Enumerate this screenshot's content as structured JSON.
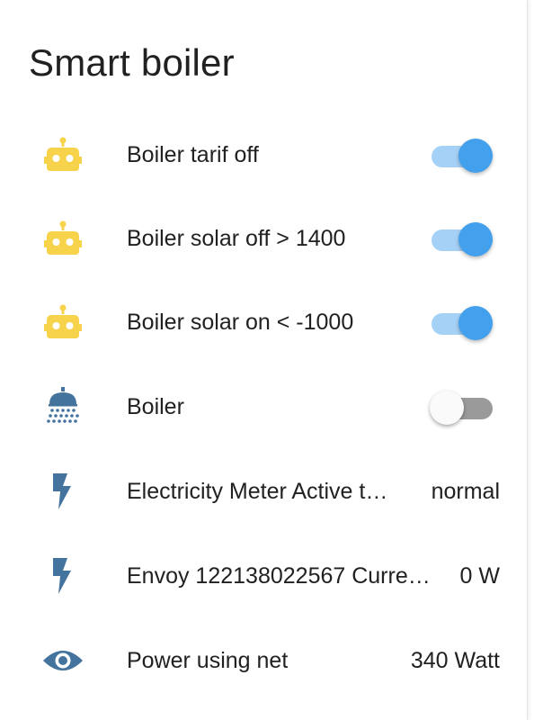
{
  "card": {
    "title": "Smart boiler"
  },
  "colors": {
    "robot_icon": "#f7d34c",
    "entity_icon": "#44739e",
    "toggle_on_knob": "#42a0ec",
    "toggle_on_track": "#a6d1f7",
    "toggle_off_track": "#9a9a9a"
  },
  "rows": [
    {
      "icon": "robot-icon",
      "name": "Boiler tarif off",
      "toggle": "on"
    },
    {
      "icon": "robot-icon",
      "name": "Boiler solar off > 1400",
      "toggle": "on"
    },
    {
      "icon": "robot-icon",
      "name": "Boiler solar on < -1000",
      "toggle": "on"
    },
    {
      "icon": "shower-icon",
      "name": "Boiler",
      "toggle": "off"
    },
    {
      "icon": "flash-icon",
      "name": "Electricity Meter Active t…",
      "state": "normal"
    },
    {
      "icon": "flash-icon",
      "name": "Envoy 122138022567 Curre…",
      "state": "0 W"
    },
    {
      "icon": "eye-icon",
      "name": "Power using net",
      "state": "340 Watt"
    }
  ]
}
